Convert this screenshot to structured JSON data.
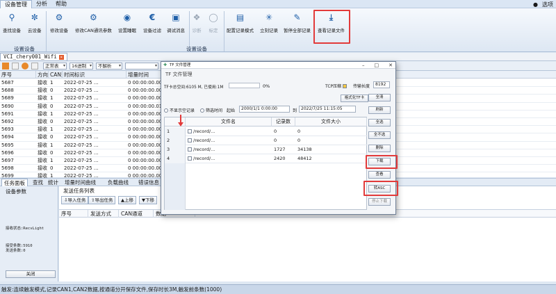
{
  "menu": {
    "items": [
      "设备管理",
      "分析",
      "帮助"
    ],
    "options_label": "选项"
  },
  "ribbon": {
    "buttons": [
      {
        "label": "查找设备",
        "icon": "search-icon"
      },
      {
        "label": "云设备",
        "icon": "cloud-icon"
      },
      {
        "label": "修改设备",
        "icon": "gear-icon"
      },
      {
        "label": "修改CAN通讯参数",
        "icon": "settings-network-icon"
      },
      {
        "label": "设置睡眠",
        "icon": "sleep-icon"
      },
      {
        "label": "设备过滤",
        "icon": "euro-icon"
      },
      {
        "label": "调试消息",
        "icon": "debug-icon"
      },
      {
        "label": "诊断",
        "icon": "diagnose-icon"
      },
      {
        "label": "标定",
        "icon": "calibrate-icon"
      },
      {
        "label": "配置记录模式",
        "icon": "record-config-icon"
      },
      {
        "label": "立刻记录",
        "icon": "bulb-icon"
      },
      {
        "label": "暂停全部记录",
        "icon": "pencil-icon"
      },
      {
        "label": "查看记录文件",
        "icon": "download-icon"
      }
    ],
    "groups": [
      "设置设备",
      "设置设备"
    ]
  },
  "device_tab": {
    "label": "VCI_chery001_Wifi"
  },
  "toolbar": {
    "mode": "正常表",
    "radix": "16进制",
    "parse": "不解析",
    "search_placeholder": ""
  },
  "grid": {
    "headers": [
      "序号",
      "方向",
      "CAN通道",
      "时间标识",
      "增量时间"
    ],
    "rows": [
      {
        "idx": "5687",
        "dir": "接收",
        "ch": "1",
        "time": "2022-07-25 ...",
        "delta": "0 00:00:00.000"
      },
      {
        "idx": "5688",
        "dir": "接收",
        "ch": "0",
        "time": "2022-07-25 ...",
        "delta": "0 00:00:00.000"
      },
      {
        "idx": "5689",
        "dir": "接收",
        "ch": "1",
        "time": "2022-07-25 ...",
        "delta": "0 00:00:00.000"
      },
      {
        "idx": "5690",
        "dir": "接收",
        "ch": "0",
        "time": "2022-07-25 ...",
        "delta": "0 00:00:00.011"
      },
      {
        "idx": "5691",
        "dir": "接收",
        "ch": "1",
        "time": "2022-07-25 ...",
        "delta": "0 00:00:00.000"
      },
      {
        "idx": "5692",
        "dir": "接收",
        "ch": "0",
        "time": "2022-07-25 ...",
        "delta": "0 00:00:00.00"
      },
      {
        "idx": "5693",
        "dir": "接收",
        "ch": "1",
        "time": "2022-07-25 ...",
        "delta": "0 00:00:00.00"
      },
      {
        "idx": "5694",
        "dir": "接收",
        "ch": "0",
        "time": "2022-07-25 ...",
        "delta": "0 00:00:00.000"
      },
      {
        "idx": "5695",
        "dir": "接收",
        "ch": "1",
        "time": "2022-07-25 ...",
        "delta": "0 00:00:00.000"
      },
      {
        "idx": "5696",
        "dir": "接收",
        "ch": "0",
        "time": "2022-07-25 ...",
        "delta": "0 00:00:00.000"
      },
      {
        "idx": "5697",
        "dir": "接收",
        "ch": "1",
        "time": "2022-07-25 ...",
        "delta": "0 00:00:00.000"
      },
      {
        "idx": "5698",
        "dir": "接收",
        "ch": "0",
        "time": "2022-07-25 ...",
        "delta": "0 00:00:00.000"
      },
      {
        "idx": "5699",
        "dir": "接收",
        "ch": "1",
        "time": "2022-07-25 ...",
        "delta": "0 00:00:00.000"
      }
    ]
  },
  "bottom_tabs": [
    "任务面板",
    "查找",
    "统计",
    "增量时间曲线",
    "负载曲线",
    "错误信息"
  ],
  "device_panel": {
    "title": "设备参数",
    "status": "接收状态:RecvLight",
    "recv": "接受条数:5910",
    "send": "发送条数:0",
    "close": "关闭"
  },
  "send_panel": {
    "title": "发送任务列表",
    "buttons": [
      "导入任务",
      "导出任务",
      "上移",
      "下移"
    ],
    "headers": [
      "序号",
      "发送方式",
      "CAN通道",
      "数据"
    ]
  },
  "status_bar": "触发:连续触发模式,记录CAN1,CAN2数据,按通道分开保存文件,保存时长3M,触发前条数(1000)",
  "dialog": {
    "title": "TF 文件管理",
    "subtitle": "TF 文件管理",
    "storage": "TF卡总空间:6105 M, 已使用:1M",
    "progress_pct": "0%",
    "progress_value": 0,
    "tcp_label": "TCP压缩",
    "chunk_label": "传输长度",
    "chunk_value": "8192",
    "format_btn": "格式化TF卡",
    "show_empty": "不显示空记录",
    "filter_time": "筛选时间",
    "start_label": "起始",
    "start_date": "2000/1/1 0:00:00",
    "to_label": "到",
    "end_date": "2022/7/25 11:15:05",
    "side_buttons": [
      "全清",
      "刷新",
      "全选",
      "全不选",
      "删除",
      "下载",
      "查看",
      "转ASC",
      "停止下载"
    ],
    "file_headers": [
      "文件名",
      "记录数",
      "文件大小"
    ],
    "files": [
      {
        "no": "1",
        "name": "/record/...",
        "count": "0",
        "size": "0"
      },
      {
        "no": "2",
        "name": "/record/...",
        "count": "0",
        "size": "0"
      },
      {
        "no": "3",
        "name": "/record/...",
        "count": "1727",
        "size": "34138"
      },
      {
        "no": "4",
        "name": "/record/...",
        "count": "2420",
        "size": "48412"
      }
    ]
  },
  "colors": {
    "highlight": "#e23a3a",
    "accent": "#1f5fa8"
  }
}
